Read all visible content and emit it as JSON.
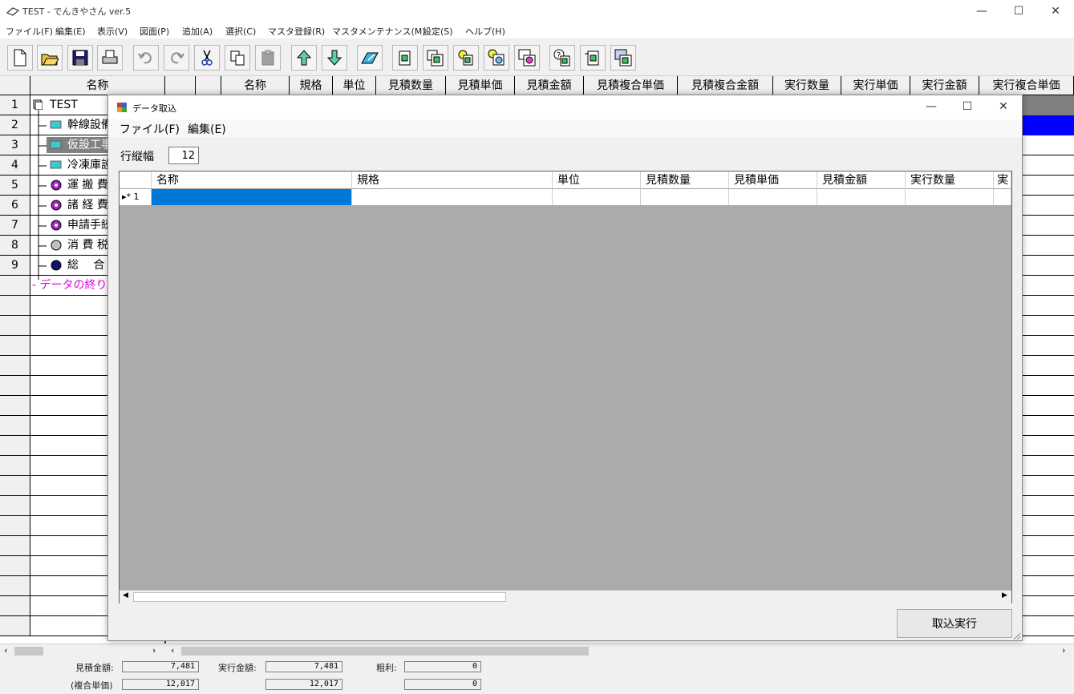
{
  "app": {
    "title": "TEST - でんきやさん ver.5",
    "menu": [
      "ファイル(F)",
      "編集(E)",
      "表示(V)",
      "図面(P)",
      "追加(A)",
      "選択(C)",
      "マスタ登録(R)",
      "マスタメンテナンス(M)",
      "設定(S)",
      "ヘルプ(H)"
    ]
  },
  "grid": {
    "name_header": "名称",
    "columns": [
      "名称",
      "規格",
      "単位",
      "見積数量",
      "見積単価",
      "見積金額",
      "見積複合単価",
      "見積複合金額",
      "実行数量",
      "実行単価",
      "実行金額",
      "実行複合単価"
    ],
    "rows": [
      {
        "num": "1",
        "name": "TEST",
        "icon": "document-icon"
      },
      {
        "num": "2",
        "name": "幹線設備",
        "icon": "monitor-icon"
      },
      {
        "num": "3",
        "name": "仮設工事",
        "icon": "monitor-icon"
      },
      {
        "num": "4",
        "name": "冷凍庫設",
        "icon": "monitor-icon"
      },
      {
        "num": "5",
        "name": "運 搬 費",
        "icon": "circle-purple-icon"
      },
      {
        "num": "6",
        "name": "諸 経 費",
        "icon": "circle-purple-icon"
      },
      {
        "num": "7",
        "name": "申請手続",
        "icon": "circle-purple-icon"
      },
      {
        "num": "8",
        "name": "消 費 税",
        "icon": "circle-gray-icon"
      },
      {
        "num": "9",
        "name": "総 　合",
        "icon": "circle-navy-icon"
      }
    ],
    "end_marker": "- データの終り -"
  },
  "status": {
    "estimate_total_label": "見積金額:",
    "estimate_total": "7,481",
    "exec_total_label": "実行金額:",
    "exec_total": "7,481",
    "gross_label": "粗利:",
    "gross": "0",
    "composite_label": "(複合単価)",
    "composite_estimate": "12,017",
    "composite_exec": "12,017",
    "composite_gross": "0"
  },
  "dialog": {
    "title": "データ取込",
    "menu": [
      "ファイル(F)",
      "編集(E)"
    ],
    "row_height_label": "行縦幅",
    "row_height_value": "12",
    "columns": [
      "名称",
      "規格",
      "単位",
      "見積数量",
      "見積単価",
      "見積金額",
      "実行数量",
      "実"
    ],
    "new_row_marker": "▸* 1",
    "import_button": "取込実行"
  },
  "colors": {
    "selection_blue": "#0078d7",
    "row_highlight": "#0000ff",
    "end_marker": "#e000e0",
    "dialog_grid_bg": "#ababab"
  }
}
